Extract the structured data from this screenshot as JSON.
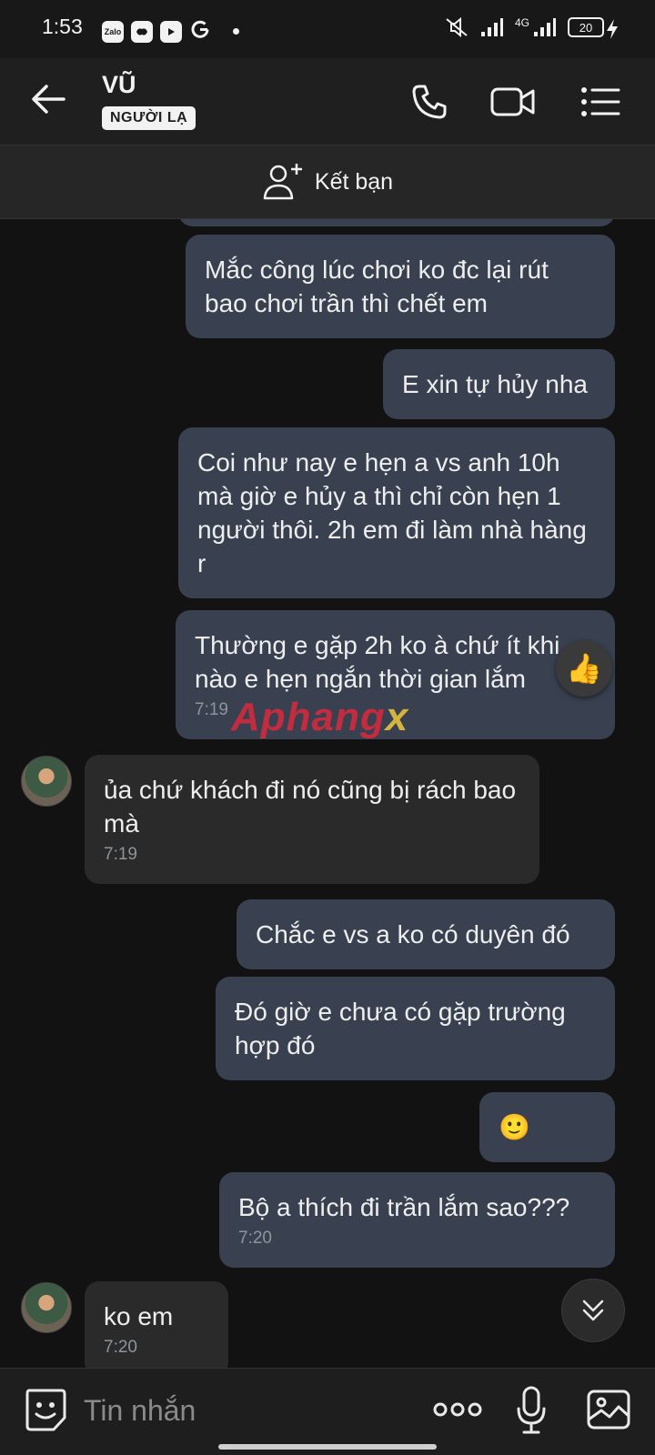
{
  "status_bar": {
    "time": "1:53",
    "app_icons": [
      "Zalo",
      "game-icon",
      "youtube-icon",
      "google-icon"
    ],
    "network": "4G",
    "battery": "20"
  },
  "header": {
    "name": "VŨ",
    "badge": "NGƯỜI LẠ"
  },
  "add_friend": {
    "label": "Kết bạn"
  },
  "messages": [
    {
      "dir": "out",
      "text": "Mắc công lúc chơi ko đc lại rút bao chơi trần thì chết em"
    },
    {
      "dir": "out",
      "text": "E xin tự hủy nha"
    },
    {
      "dir": "out",
      "text": "Coi như nay e hẹn a vs anh 10h mà giờ e hủy a thì chỉ còn hẹn 1 người thôi. 2h em đi làm nhà hàng r"
    },
    {
      "dir": "out",
      "text": "Thường e gặp 2h ko à chứ ít khi nào e hẹn ngắn thời gian lắm",
      "time": "7:19",
      "reaction": "👍"
    },
    {
      "dir": "in",
      "text": "ủa chứ khách đi nó cũng bị rách bao mà",
      "time": "7:19"
    },
    {
      "dir": "out",
      "text": "Chắc e vs a ko có duyên đó"
    },
    {
      "dir": "out",
      "text": "Đó giờ e chưa có gặp trường hợp đó"
    },
    {
      "dir": "out",
      "text": "🙂"
    },
    {
      "dir": "out",
      "text": "Bộ a thích đi trần lắm sao???",
      "time": "7:20"
    },
    {
      "dir": "in",
      "text": "ko em",
      "time": "7:20"
    }
  ],
  "watermark": {
    "main": "Aphang",
    "accent": "x"
  },
  "input": {
    "placeholder": "Tin nhắn"
  },
  "colors": {
    "outgoing_bubble": "#394150",
    "incoming_bubble": "#2a2a2a",
    "background": "#121212"
  }
}
